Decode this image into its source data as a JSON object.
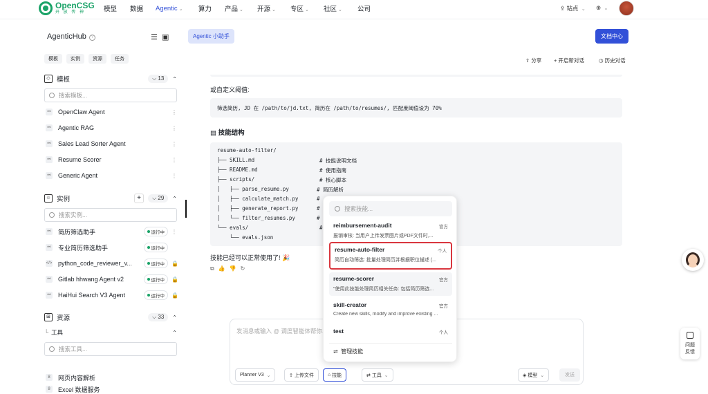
{
  "brand": {
    "name": "OpenCSG",
    "sub": "开 放 传 神"
  },
  "nav": [
    "模型",
    "数据",
    "Agentic",
    "算力",
    "产品",
    "开源",
    "专区",
    "社区",
    "公司"
  ],
  "topbar": {
    "site": "站点",
    "lang_icon": "globe-icon"
  },
  "sidebar": {
    "title": "AgenticHub",
    "chips": [
      "模板",
      "实例",
      "资源",
      "任务"
    ],
    "templates": {
      "label": "模板",
      "count": "13",
      "search_placeholder": "搜索模板...",
      "items": [
        "OpenClaw Agent",
        "Agentic RAG",
        "Sales Lead Sorter Agent",
        "Resume Scorer",
        "Generic Agent"
      ]
    },
    "instances": {
      "label": "实例",
      "count": "29",
      "search_placeholder": "搜索实例...",
      "items": [
        {
          "name": "简历筛选助手",
          "status": "运行中"
        },
        {
          "name": "专业简历筛选助手",
          "status": "运行中"
        },
        {
          "name": "python_code_reviewer_v...",
          "status": "运行中"
        },
        {
          "name": "Gitlab hhwang Agent v2",
          "status": "运行中"
        },
        {
          "name": "HaiHui Search V3 Agent",
          "status": "运行中"
        }
      ]
    },
    "resources": {
      "label": "资源",
      "count": "33",
      "sub": "工具",
      "search_placeholder": "搜索工具...",
      "items": [
        "网页内容解析",
        "Excel 数据服务"
      ]
    }
  },
  "main": {
    "tab": "Agentic 小助手",
    "docs_button": "文档中心",
    "actions": [
      "分享",
      "开启新对话",
      "历史对话"
    ],
    "line1": "或自定义阈值:",
    "code1": "筛选简历, JD 在 /path/to/jd.txt, 简历在 /path/to/resumes/, 匹配度阈值设为 70%",
    "heading": "技能结构",
    "tree": [
      {
        "t": "resume-auto-filter/",
        "c": ""
      },
      {
        "t": "├── SKILL.md",
        "c": "# 技能说明文档"
      },
      {
        "t": "├── README.md",
        "c": "# 使用指南"
      },
      {
        "t": "├── scripts/",
        "c": "# 核心脚本"
      },
      {
        "t": "│   ├── parse_resume.py",
        "c": "# 简历解析"
      },
      {
        "t": "│   ├── calculate_match.py",
        "c": "#"
      },
      {
        "t": "│   ├── generate_report.py",
        "c": "#"
      },
      {
        "t": "│   └── filter_resumes.py",
        "c": "#"
      },
      {
        "t": "└── evals/",
        "c": "#"
      },
      {
        "t": "    └── evals.json",
        "c": ""
      }
    ],
    "done": "技能已经可以正常使用了! 🎉"
  },
  "popup": {
    "search_placeholder": "搜索技能...",
    "skills": [
      {
        "name": "reimbursement-audit",
        "tag": "官方",
        "desc": "报销审核: 当用户上传发票图片或PDF文件时,..."
      },
      {
        "name": "resume-auto-filter",
        "tag": "个人",
        "desc": "简历自动筛选: 批量处理简历并根据职位描述 (..."
      },
      {
        "name": "resume-scorer",
        "tag": "官方",
        "desc": "\"使用此技能处理简历相关任务: 包括简历筛选..."
      },
      {
        "name": "skill-creator",
        "tag": "官方",
        "desc": "Create new skills, modify and improve existing ..."
      },
      {
        "name": "test",
        "tag": "个人",
        "desc": ""
      }
    ],
    "manage": "管理技能"
  },
  "composer": {
    "placeholder": "发消息或输入 @ 调度智能体帮你...",
    "planner": "Planner V3",
    "upload": "上传文件",
    "skill": "技能",
    "tools": "工具",
    "model": "模型",
    "send": "发送"
  },
  "feedback": {
    "line1": "问题",
    "line2": "反馈"
  }
}
